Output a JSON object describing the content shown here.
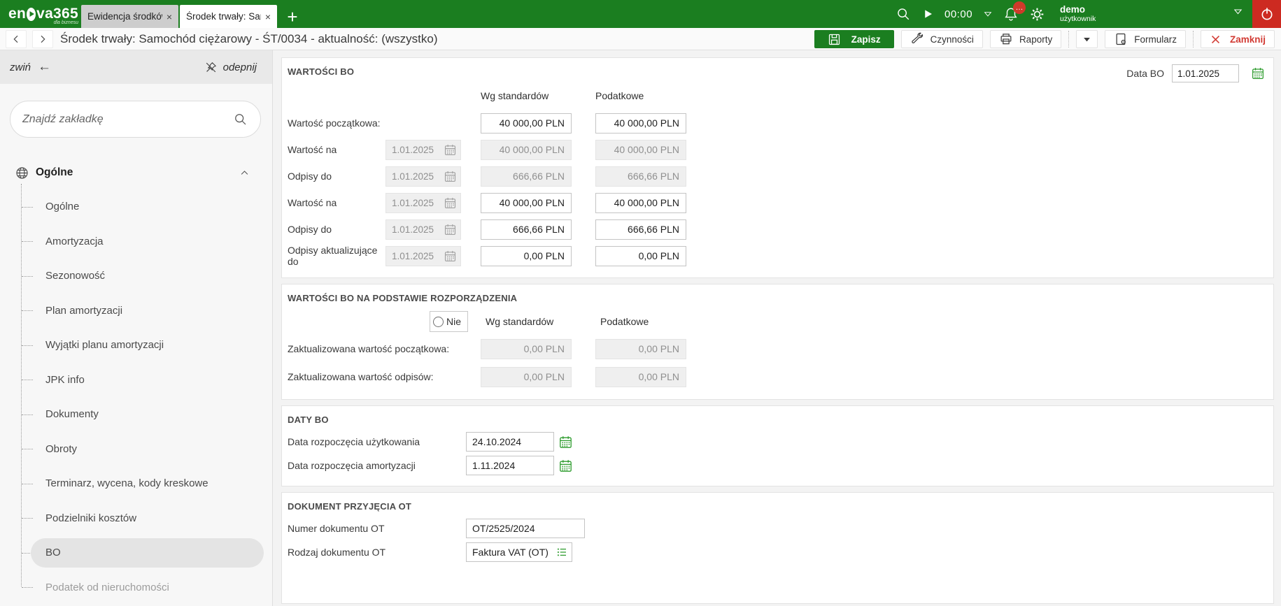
{
  "colors": {
    "brand_green": "#1b7e20",
    "accent_green": "#2c9b2c",
    "close_red": "#d23b34",
    "selected_gray": "#e4e4e4"
  },
  "icons": {
    "search-icon": "magnifier",
    "play-icon": "play-triangle",
    "timer-chevron-icon": "nabla-down",
    "bell-icon": "bell-with-badge",
    "gear-icon": "gear",
    "power-icon": "power",
    "save-floppy-icon": "floppy-disk",
    "wrench-icon": "wrench",
    "printer-icon": "printer",
    "form-icon": "document-gear",
    "close-x-icon": "red-x",
    "calendar-icon": "calendar-grid",
    "list-icon": "green-list",
    "globe-icon": "globe",
    "pin-slash-icon": "unpin",
    "arrow-left-icon": "left-arrow",
    "chevron-up-icon": "caret-up"
  },
  "topbar": {
    "logo_left": "en",
    "logo_right": "va365",
    "logo_tagline": "dla biznesu",
    "tabs": [
      {
        "label": "Ewidencja środków tr..."
      },
      {
        "label": "Środek trwały: Sam..."
      }
    ],
    "timer": "00:00",
    "notification_badge": "…",
    "user_name": "demo",
    "user_role": "użytkownik"
  },
  "titlebar": {
    "title": "Środek trwały: Samochód ciężarowy - ŚT/0034 - aktualność: (wszystko)",
    "save_label": "Zapisz",
    "actions_label": "Czynności",
    "reports_label": "Raporty",
    "form_label": "Formularz",
    "close_label": "Zamknij"
  },
  "sidebar": {
    "collapse_label": "zwiń",
    "unpin_label": "odepnij",
    "search_placeholder": "Znajdź zakładkę",
    "tree": {
      "root": "Ogólne",
      "items": [
        "Ogólne",
        "Amortyzacja",
        "Sezonowość",
        "Plan amortyzacji",
        "Wyjątki planu amortyzacji",
        "JPK info",
        "Dokumenty",
        "Obroty",
        "Terminarz, wycena, kody kreskowe",
        "Podzielniki kosztów",
        "BO",
        "Podatek od nieruchomości"
      ],
      "selected": "BO"
    }
  },
  "content": {
    "data_bo": {
      "label": "Data BO",
      "value": "1.01.2025"
    },
    "columns": {
      "std": "Wg standardów",
      "tax": "Podatkowe"
    },
    "wartosci_bo": {
      "title": "WARTOŚCI BO",
      "rows": [
        {
          "label": "Wartość początkowa:",
          "date": "",
          "std": "40 000,00 PLN",
          "tax": "40 000,00 PLN"
        },
        {
          "label": "Wartość na",
          "date": "1.01.2025",
          "std": "40 000,00 PLN",
          "tax": "40 000,00 PLN"
        },
        {
          "label": "Odpisy do",
          "date": "1.01.2025",
          "std": "666,66 PLN",
          "tax": "666,66 PLN"
        },
        {
          "label": "Wartość na",
          "date": "1.01.2025",
          "std": "40 000,00 PLN",
          "tax": "40 000,00 PLN"
        },
        {
          "label": "Odpisy do",
          "date": "1.01.2025",
          "std": "666,66 PLN",
          "tax": "666,66 PLN"
        },
        {
          "label": "Odpisy aktualizujące do",
          "date": "1.01.2025",
          "std": "0,00 PLN",
          "tax": "0,00 PLN"
        }
      ]
    },
    "rozporzadzenie": {
      "title": "WARTOŚCI BO NA PODSTAWIE ROZPORZĄDZENIA",
      "radio_label": "Nie",
      "rows": [
        {
          "label": "Zaktualizowana wartość początkowa:",
          "std": "0,00 PLN",
          "tax": "0,00 PLN"
        },
        {
          "label": "Zaktualizowana wartość odpisów:",
          "std": "0,00 PLN",
          "tax": "0,00 PLN"
        }
      ]
    },
    "daty_bo": {
      "title": "DATY BO",
      "rows": [
        {
          "label": "Data rozpoczęcia użytkowania",
          "value": "24.10.2024"
        },
        {
          "label": "Data rozpoczęcia amortyzacji",
          "value": "1.11.2024"
        }
      ]
    },
    "dokument_ot": {
      "title": "DOKUMENT PRZYJĘCIA OT",
      "rows": [
        {
          "label": "Numer dokumentu OT",
          "value": "OT/2525/2024"
        },
        {
          "label": "Rodzaj dokumentu OT",
          "value": "Faktura VAT (OT)"
        }
      ]
    }
  }
}
